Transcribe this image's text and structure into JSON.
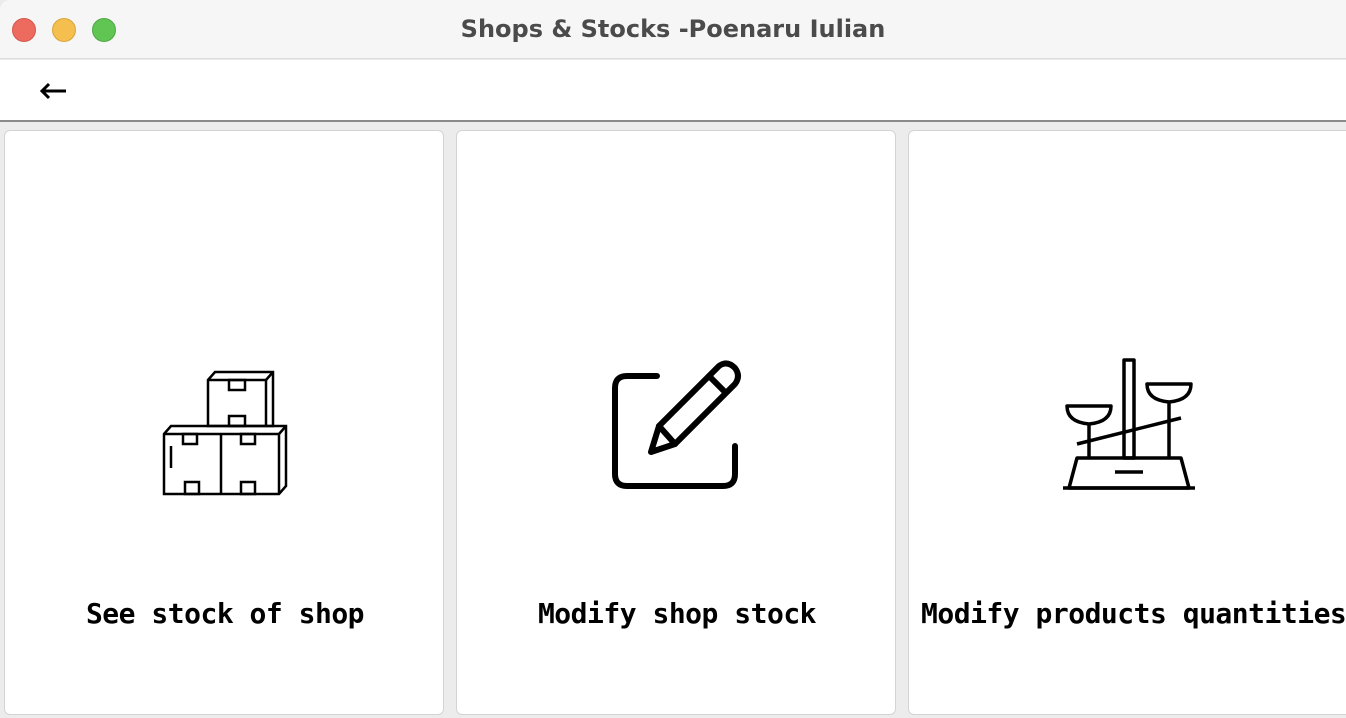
{
  "window": {
    "title": "Shops & Stocks -Poenaru Iulian"
  },
  "toolbar": {
    "back_icon": "left-arrow-icon"
  },
  "cards": [
    {
      "label": "See stock of shop",
      "icon": "stacked-boxes-icon"
    },
    {
      "label": "Modify shop stock",
      "icon": "edit-pencil-icon"
    },
    {
      "label": "Modify products quantities",
      "icon": "balance-scale-icon"
    }
  ],
  "colors": {
    "close": "#ed6a5e",
    "minimize": "#f5bf4f",
    "maximize": "#61c554",
    "titlebar": "#f6f6f6",
    "background": "#ececec"
  }
}
